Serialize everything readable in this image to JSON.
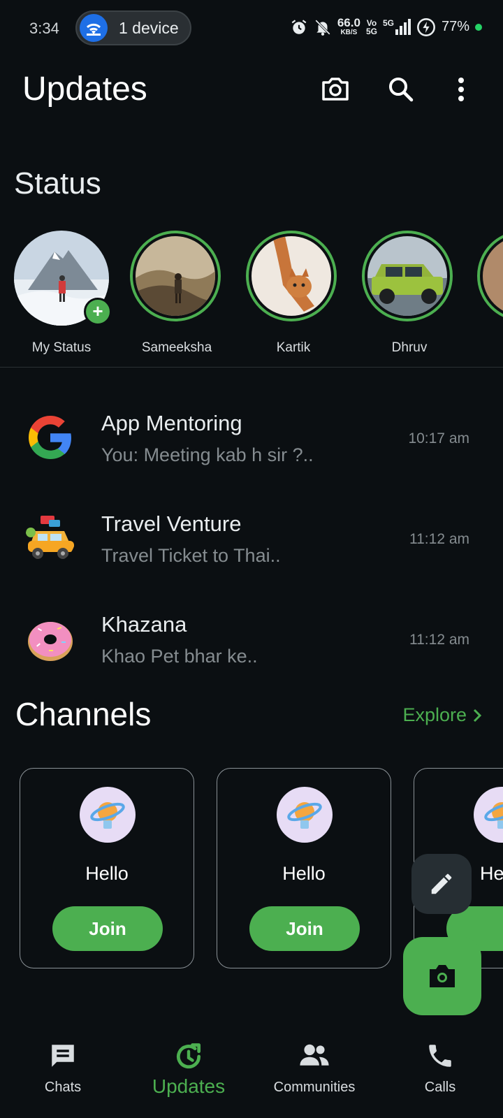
{
  "status_bar": {
    "time": "3:34",
    "hotspot_label": "1 device",
    "net_speed": "66.0",
    "net_unit": "KB/S",
    "volte_top": "Vo",
    "volte_bottom": "5G",
    "signal_label": "5G",
    "battery": "77%",
    "icons": [
      "wifi-icon",
      "alarm-icon",
      "mute-icon",
      "signal-icon",
      "battery-charging-icon"
    ]
  },
  "header": {
    "title": "Updates",
    "icons": [
      "camera-icon",
      "search-icon",
      "more-icon"
    ]
  },
  "status": {
    "heading": "Status",
    "items": [
      {
        "label": "My Status"
      },
      {
        "label": "Sameeksha"
      },
      {
        "label": "Kartik"
      },
      {
        "label": "Dhruv"
      }
    ]
  },
  "chats": [
    {
      "title": "App Mentoring",
      "subtitle": "You: Meeting kab h sir ?..",
      "time": "10:17 am",
      "avatar": "google-logo"
    },
    {
      "title": "Travel Venture",
      "subtitle": "Travel Ticket to Thai..",
      "time": "11:12 am",
      "avatar": "car-emoji"
    },
    {
      "title": "Khazana",
      "subtitle": "Khao Pet bhar ke..",
      "time": "11:12 am",
      "avatar": "donut-emoji"
    }
  ],
  "channels": {
    "heading": "Channels",
    "explore": "Explore",
    "cards": [
      {
        "name": "Hello",
        "join": "Join"
      },
      {
        "name": "Hello",
        "join": "Join"
      },
      {
        "name": "He",
        "join": "Jo"
      }
    ]
  },
  "bottom_nav": [
    {
      "label": "Chats",
      "icon": "chats-icon"
    },
    {
      "label": "Updates",
      "icon": "updates-icon",
      "active": true
    },
    {
      "label": "Communities",
      "icon": "communities-icon"
    },
    {
      "label": "Calls",
      "icon": "calls-icon"
    }
  ],
  "colors": {
    "accent": "#4caf50",
    "background": "#0b0f12",
    "muted": "#858c90"
  }
}
